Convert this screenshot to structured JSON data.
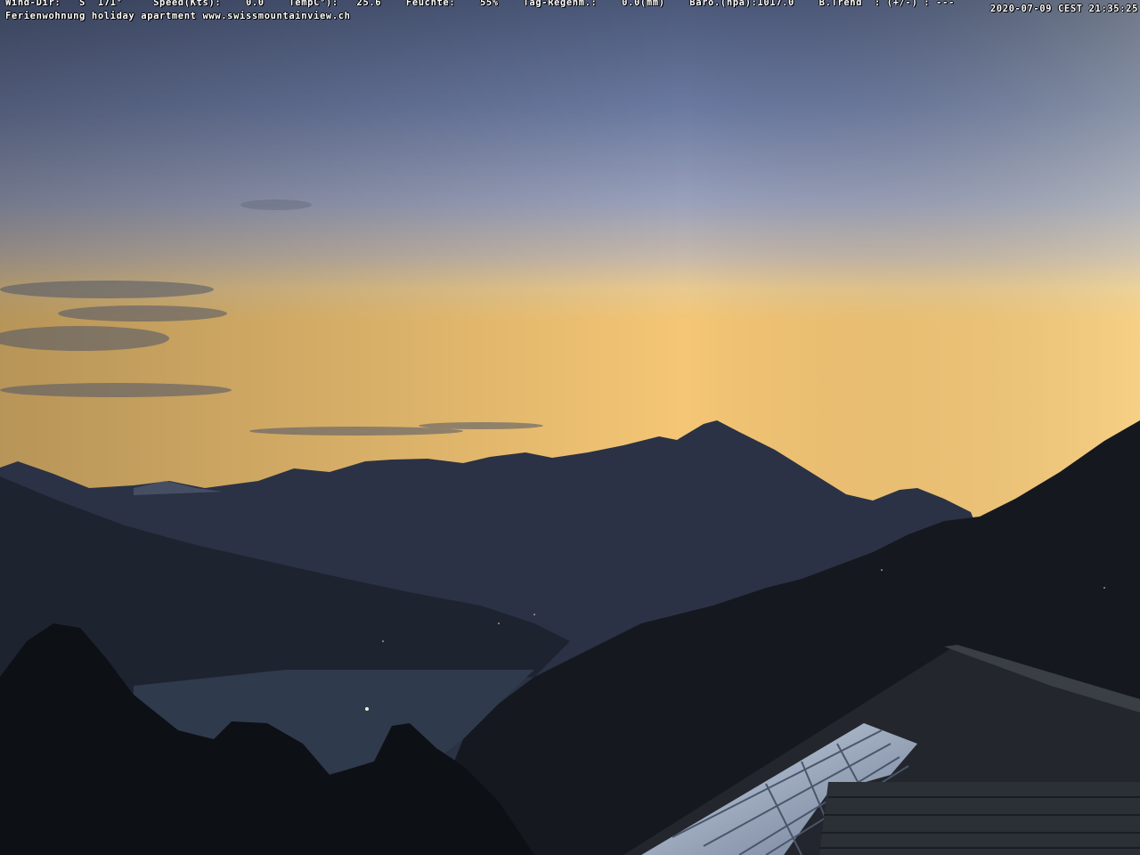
{
  "overlay": {
    "weather_line": "Wind-Dir:   S  171°     Speed(Kts):    0.0    TempC°):   25.6    Feuchte:    55%    Tag-Regenm.:    0.0(mm)    Baro.(hpa):1017.0    B.Trend  : (+/-) : ---",
    "info_line": "Ferienwohnung holiday apartment www.swissmountainview.ch",
    "timestamp": "2020-07-09 CEST 21:35:25"
  },
  "colors": {
    "sky_top": "#4c5a7c",
    "sky_horizon": "#f3c87a",
    "mountains": "#2a3142",
    "foreground": "#0f1217",
    "lake": "#2f3a4c"
  }
}
